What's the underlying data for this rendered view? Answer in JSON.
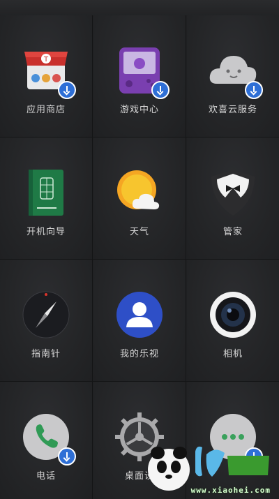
{
  "apps": [
    {
      "label": "应用商店",
      "icon": "app-store-icon",
      "badge": true
    },
    {
      "label": "游戏中心",
      "icon": "game-center-icon",
      "badge": true
    },
    {
      "label": "欢喜云服务",
      "icon": "cloud-service-icon",
      "badge": true
    },
    {
      "label": "开机向导",
      "icon": "setup-wizard-icon",
      "badge": false
    },
    {
      "label": "天气",
      "icon": "weather-icon",
      "badge": false
    },
    {
      "label": "管家",
      "icon": "butler-icon",
      "badge": false
    },
    {
      "label": "指南针",
      "icon": "compass-icon",
      "badge": false
    },
    {
      "label": "我的乐视",
      "icon": "my-letv-icon",
      "badge": false
    },
    {
      "label": "相机",
      "icon": "camera-icon",
      "badge": false
    },
    {
      "label": "电话",
      "icon": "phone-icon",
      "badge": true
    },
    {
      "label": "桌面设",
      "icon": "settings-gear-icon",
      "badge": false
    },
    {
      "label": "",
      "icon": "messages-icon",
      "badge": true
    }
  ],
  "watermark": {
    "url": "www.xiaohei.com"
  },
  "colors": {
    "badge": "#2e6fd6",
    "background": "#1f2022"
  }
}
